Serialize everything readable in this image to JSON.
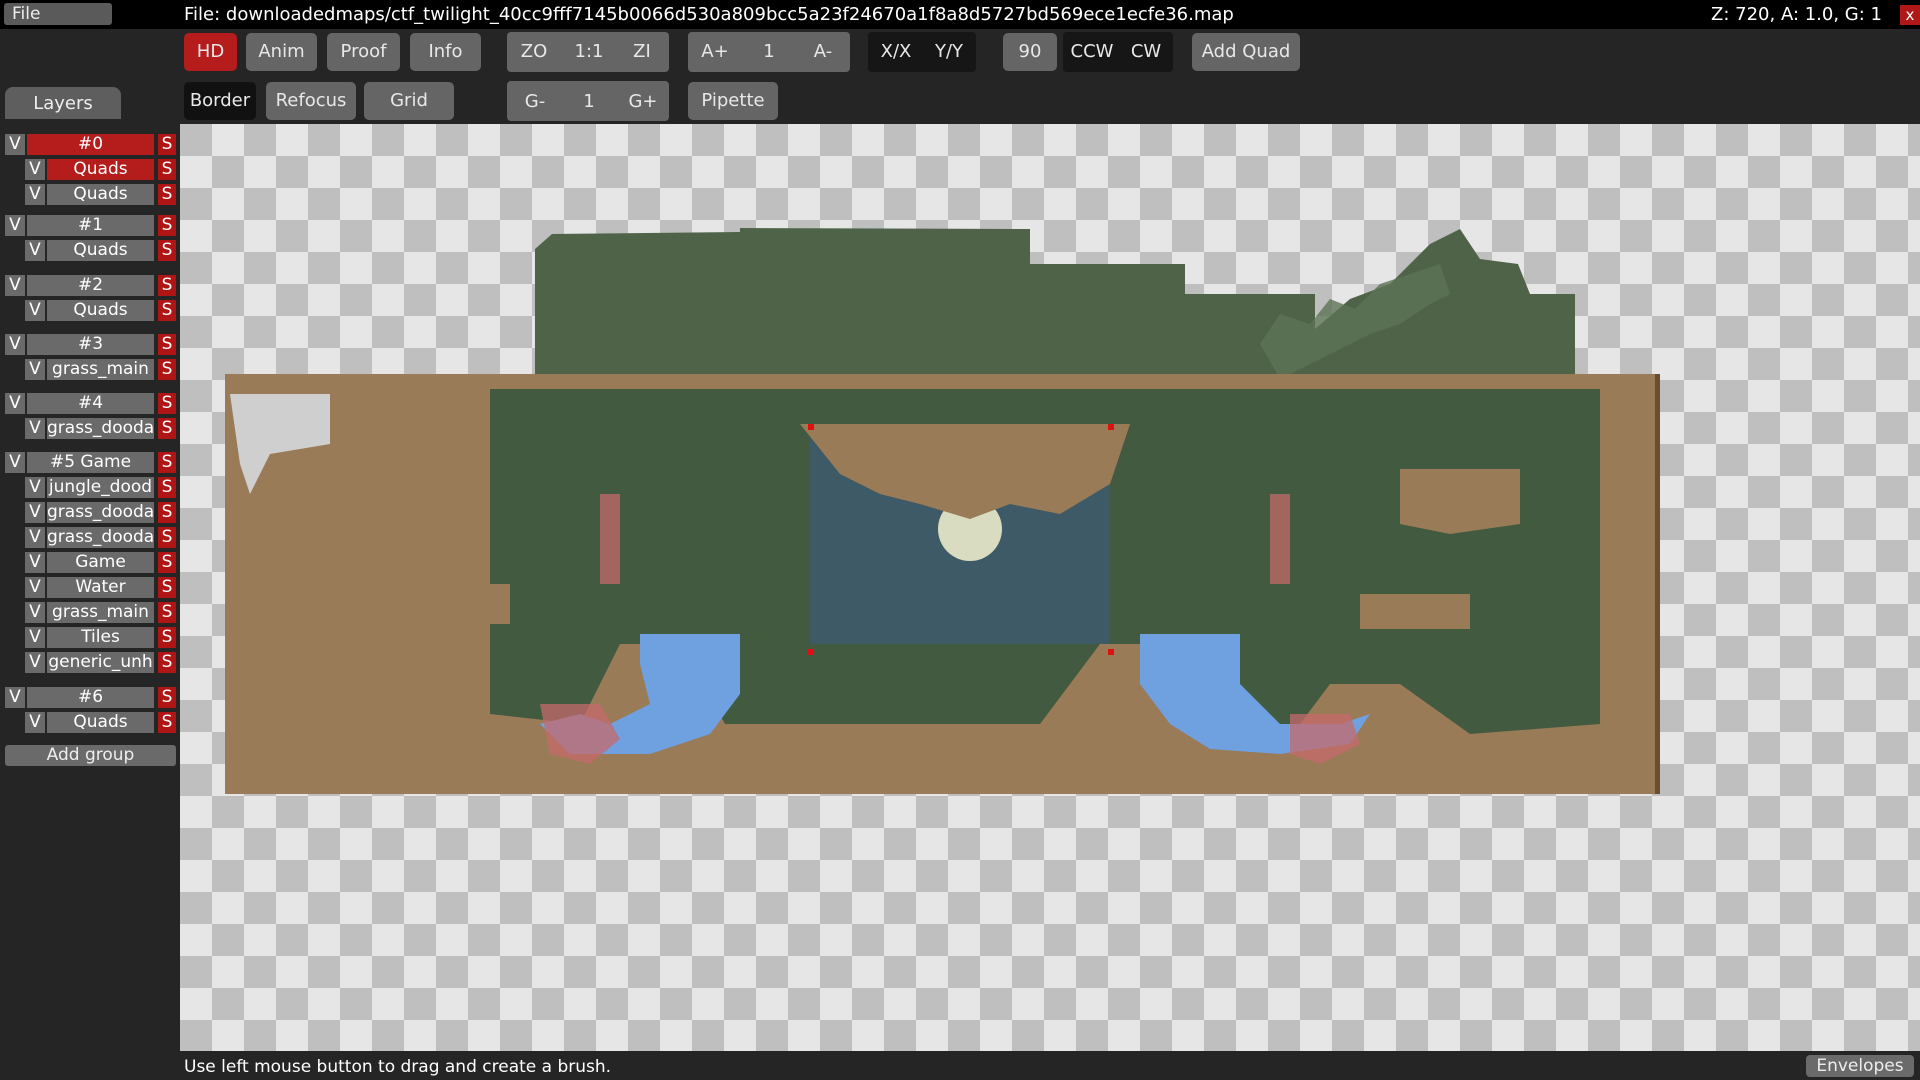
{
  "menu": {
    "file_label": "File"
  },
  "title": "File: downloadedmaps/ctf_twilight_40cc9fff7145b0066d530a809bcc5a23f24670a1f8a8d5727bd569ece1ecfe36.map",
  "zoom_info": "Z: 720, A: 1.0, G: 1",
  "close_label": "x",
  "toolbar": {
    "hd": "HD",
    "anim": "Anim",
    "proof": "Proof",
    "info": "Info",
    "zo": "ZO",
    "one_one": "1:1",
    "zi": "ZI",
    "a_plus": "A+",
    "a_val": "1",
    "a_minus": "A-",
    "xx": "X/X",
    "yy": "Y/Y",
    "rot": "90",
    "ccw": "CCW",
    "cw": "CW",
    "add_quad": "Add Quad",
    "border": "Border",
    "refocus": "Refocus",
    "grid": "Grid",
    "g_minus": "G-",
    "g_val": "1",
    "g_plus": "G+",
    "pipette": "Pipette"
  },
  "layers": {
    "tab_label": "Layers",
    "v": "V",
    "s": "S",
    "groups": [
      {
        "name": "#0",
        "layers": [
          "Quads",
          "Quads"
        ]
      },
      {
        "name": "#1",
        "layers": [
          "Quads"
        ]
      },
      {
        "name": "#2",
        "layers": [
          "Quads"
        ]
      },
      {
        "name": "#3",
        "layers": [
          "grass_main"
        ]
      },
      {
        "name": "#4",
        "layers": [
          "grass_dooda"
        ]
      },
      {
        "name": "#5 Game",
        "layers": [
          "jungle_dood",
          "grass_dooda",
          "grass_dooda",
          "Game",
          "Water",
          "grass_main",
          "Tiles",
          "generic_unh"
        ]
      },
      {
        "name": "#6",
        "layers": [
          "Quads"
        ]
      }
    ],
    "add_group": "Add group"
  },
  "status": "Use left mouse button to drag and create a brush.",
  "envelopes": "Envelopes",
  "colors": {
    "accent_red": "#b51d1d",
    "button_gray": "#656565",
    "dirt": "#9a7b58",
    "foliage": "#4f6349",
    "water": "#6fa0e0"
  }
}
